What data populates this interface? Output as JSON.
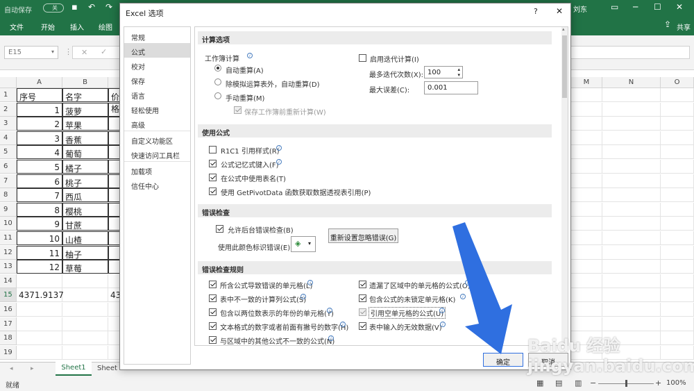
{
  "titlebar": {
    "autosave_label": "自动保存",
    "autosave_state": "关",
    "user": "刘东"
  },
  "ribbon": {
    "tabs": [
      "文件",
      "开始",
      "插入",
      "绘图"
    ],
    "share": "共享"
  },
  "formula_bar": {
    "name_box": "E15"
  },
  "sheet": {
    "columns": [
      "A",
      "B"
    ],
    "right_columns": [
      "M",
      "N",
      "O"
    ],
    "rows": [
      "1",
      "2",
      "3",
      "4",
      "5",
      "6",
      "7",
      "8",
      "9",
      "10",
      "11",
      "12",
      "13",
      "14",
      "15",
      "16",
      "17",
      "18",
      "19"
    ],
    "header": [
      "序号",
      "名字",
      "价格"
    ],
    "data": [
      [
        "1",
        "菠萝"
      ],
      [
        "2",
        "苹果"
      ],
      [
        "3",
        "香蕉"
      ],
      [
        "4",
        "葡萄"
      ],
      [
        "5",
        "橘子"
      ],
      [
        "6",
        "桃子"
      ],
      [
        "7",
        "西瓜"
      ],
      [
        "8",
        "樱桃"
      ],
      [
        "9",
        "甘蔗"
      ],
      [
        "10",
        "山楂"
      ],
      [
        "11",
        "柚子"
      ],
      [
        "12",
        "草莓"
      ]
    ],
    "total_a": "4371.9137",
    "total_c": "43",
    "tab": "Sheet1",
    "tab2": "Sheet"
  },
  "status": {
    "ready": "就绪",
    "zoom": "100%"
  },
  "dialog": {
    "title": "Excel 选项",
    "help": "?",
    "close": "✕",
    "nav": [
      "常规",
      "公式",
      "校对",
      "保存",
      "语言",
      "轻松使用",
      "高级",
      "自定义功能区",
      "快速访问工具栏",
      "加载项",
      "信任中心"
    ],
    "selected_nav": "公式",
    "calc": {
      "section": "计算选项",
      "workbook_calc": "工作簿计算",
      "auto": "自动重算(A)",
      "auto_except": "除模拟运算表外，自动重算(D)",
      "manual": "手动重算(M)",
      "recalc_before_save": "保存工作簿前重新计算(W)",
      "iterative": "启用迭代计算(I)",
      "max_iter_label": "最多迭代次数(X):",
      "max_iter": "100",
      "max_change_label": "最大误差(C):",
      "max_change": "0.001"
    },
    "formulas": {
      "section": "使用公式",
      "r1c1": "R1C1 引用样式(R)",
      "autocomplete": "公式记忆式键入(F)",
      "table_names": "在公式中使用表名(T)",
      "pivot": "使用 GetPivotData 函数获取数据透视表引用(P)"
    },
    "errcheck": {
      "section": "错误检查",
      "enable_bg": "允许后台错误检查(B)",
      "color_label": "使用此颜色标识错误(E):",
      "reset": "重新设置忽略错误(G)"
    },
    "rules": {
      "section": "错误检查规则",
      "left": [
        "所含公式导致错误的单元格(L)",
        "表中不一致的计算列公式(S)",
        "包含以两位数表示的年份的单元格(Y)",
        "文本格式的数字或者前面有撇号的数字(H)",
        "与区域中的其他公式不一致的公式(N)"
      ],
      "right": [
        "遗漏了区域中的单元格的公式(O)",
        "包含公式的未锁定单元格(K)",
        "引用空单元格的公式(U)",
        "表中输入的无效数据(V)"
      ]
    },
    "ok": "确定",
    "cancel": "取消"
  },
  "colors": {
    "excel_green": "#217346",
    "arrow_blue": "#2f6fe0"
  },
  "watermark": "Baidu 经验 jingyan.baidu.com"
}
